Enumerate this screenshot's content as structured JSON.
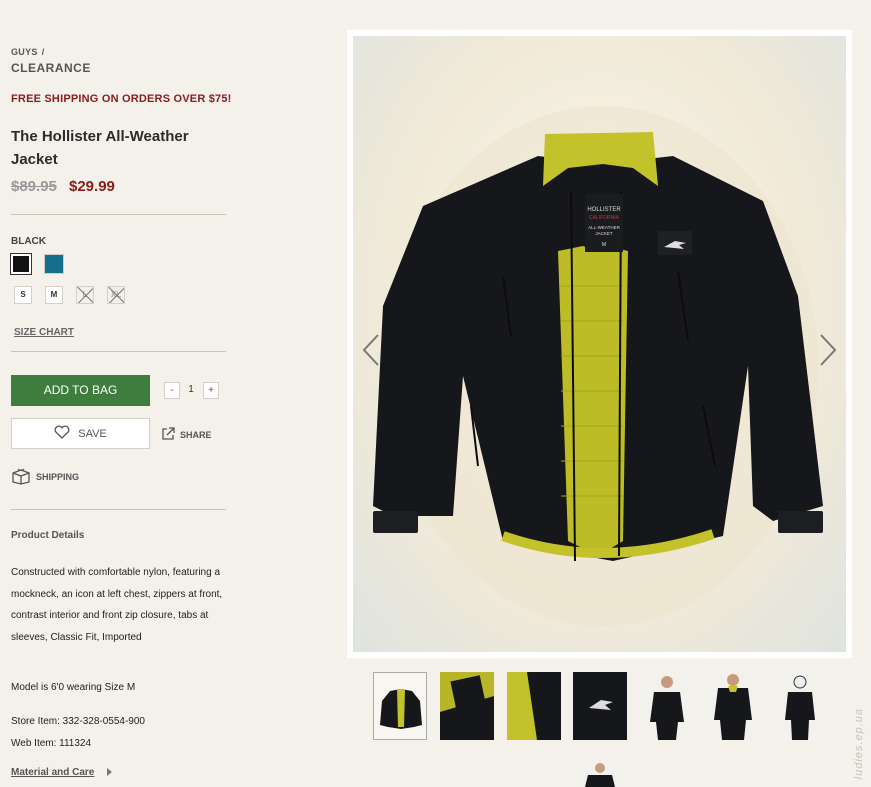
{
  "breadcrumb": {
    "parent": "GUYS",
    "separator": "/",
    "current": "CLEARANCE"
  },
  "promo": "FREE SHIPPING ON ORDERS OVER $75!",
  "product": {
    "title": "The Hollister All-Weather Jacket",
    "price_original": "$89.95",
    "price_sale": "$29.99",
    "color_label": "BLACK",
    "swatches": [
      {
        "name": "Black",
        "color": "#111111",
        "selected": true
      },
      {
        "name": "Teal",
        "color": "#17708b",
        "selected": false
      }
    ],
    "sizes": [
      {
        "label": "S",
        "available": true
      },
      {
        "label": "M",
        "available": true
      },
      {
        "label": "L",
        "available": false
      },
      {
        "label": "XL",
        "available": false
      }
    ],
    "size_chart": "SIZE CHART",
    "add_to_bag": "ADD TO BAG",
    "quantity": {
      "minus": "-",
      "value": "1",
      "plus": "+"
    },
    "save": "SAVE",
    "share": "SHARE",
    "shipping": "SHIPPING"
  },
  "details": {
    "title": "Product Details",
    "description": "Constructed with comfortable nylon, featuring a mockneck, an icon at left chest, zippers at front, contrast interior and front zip closure, tabs at sleeves, Classic Fit, Imported",
    "model": "Model is 6'0 wearing Size M",
    "store_item": "Store Item: 332-328-0554-900",
    "web_item": "Web Item: 111324",
    "material_link": "Material and Care"
  },
  "jacket_label": {
    "line1": "HOLLISTER",
    "line2": "CALIFORNIA",
    "line3": "ALL-WEATHER",
    "line4": "JACKET",
    "line5": "M"
  },
  "gallery": {
    "thumbnail_count": 8,
    "active_index": 0
  },
  "watermark": "ludies.ep.ua",
  "colors": {
    "accent_green": "#3e7d3e",
    "sale_red": "#8a1c1c",
    "jacket_yellow": "#c4c22a",
    "jacket_black": "#16171a"
  }
}
